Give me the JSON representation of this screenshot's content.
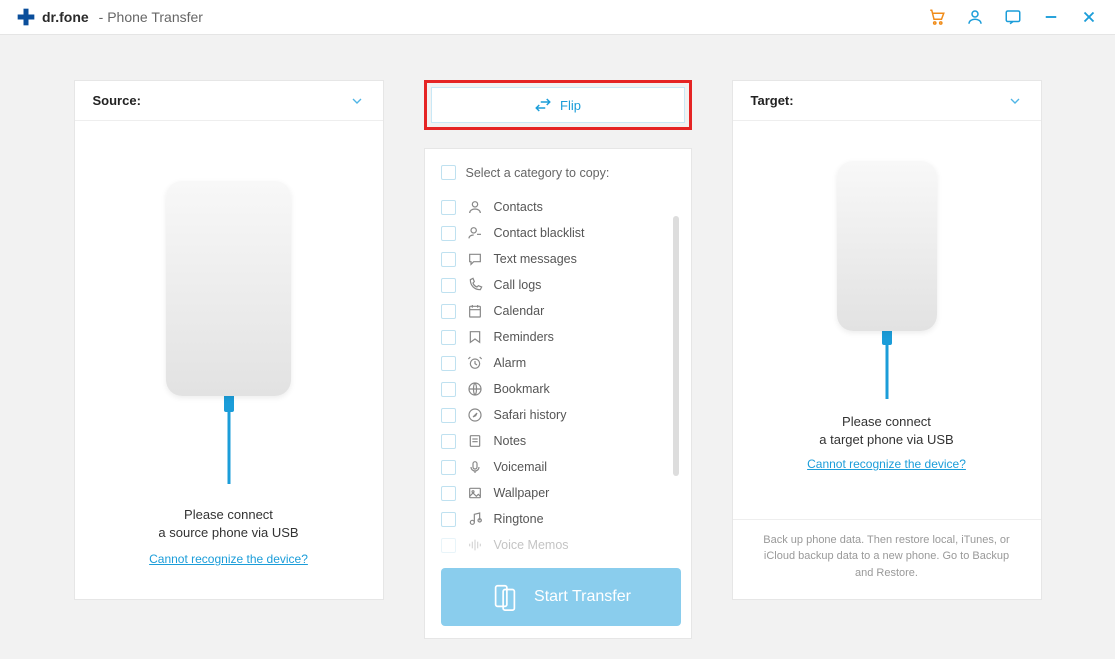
{
  "app": {
    "name": "dr.fone",
    "subtitle": "- Phone Transfer"
  },
  "source": {
    "label": "Source:",
    "connect_line1": "Please connect",
    "connect_line2": "a source phone via USB",
    "help_link": "Cannot recognize the device?"
  },
  "target": {
    "label": "Target:",
    "connect_line1": "Please connect",
    "connect_line2": "a target phone via USB",
    "help_link": "Cannot recognize the device?",
    "footer_note": "Back up phone data. Then restore local, iTunes, or iCloud backup data to a new phone. Go to Backup and Restore."
  },
  "middle": {
    "flip_label": "Flip",
    "select_all_label": "Select a category to copy:",
    "start_label": "Start Transfer",
    "categories": [
      "Contacts",
      "Contact blacklist",
      "Text messages",
      "Call logs",
      "Calendar",
      "Reminders",
      "Alarm",
      "Bookmark",
      "Safari history",
      "Notes",
      "Voicemail",
      "Wallpaper",
      "Ringtone",
      "Voice Memos"
    ]
  }
}
